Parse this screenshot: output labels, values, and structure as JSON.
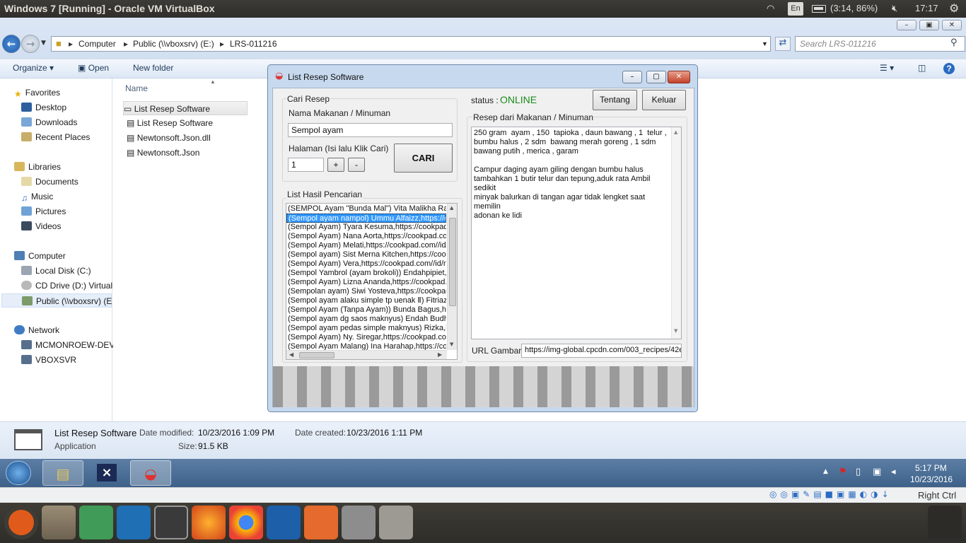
{
  "topbar": {
    "title": "Windows 7 [Running] - Oracle VM VirtualBox",
    "lang": "En",
    "battery": "(3:14, 86%)",
    "time": "17:17"
  },
  "explorer": {
    "breadcrumb": [
      "Computer",
      "Public (\\\\vboxsrv) (E:)",
      "LRS-011216"
    ],
    "search_placeholder": "Search LRS-011216",
    "cmd": {
      "organize": "Organize",
      "open": "Open",
      "new_folder": "New folder"
    },
    "column_name": "Name",
    "nav": {
      "favorites": "Favorites",
      "desktop": "Desktop",
      "downloads": "Downloads",
      "recent": "Recent Places",
      "libraries": "Libraries",
      "documents": "Documents",
      "music": "Music",
      "pictures": "Pictures",
      "videos": "Videos",
      "computer": "Computer",
      "local_disk": "Local Disk (C:)",
      "cd_drive": "CD Drive (D:) Virtual",
      "public": "Public (\\\\vboxsrv) (E",
      "network": "Network",
      "mcm": "MCMONROEW-DEV",
      "vboxsvr": "VBOXSVR"
    },
    "files": [
      "List Resep Software",
      "List Resep Software",
      "Newtonsoft.Json.dll",
      "Newtonsoft.Json"
    ],
    "details": {
      "name": "List Resep Software",
      "type": "Application",
      "modified_label": "Date modified:",
      "modified": "10/23/2016 1:09 PM",
      "created_label": "Date created:",
      "created": "10/23/2016 1:11 PM",
      "size_label": "Size:",
      "size": "91.5 KB"
    }
  },
  "taskbar": {
    "time": "5:17 PM",
    "date": "10/23/2016"
  },
  "vbox_status": {
    "host_key": "Right Ctrl"
  },
  "dialog": {
    "title": "List Resep Software",
    "group_search": "Cari Resep",
    "label_food": "Nama Makanan / Minuman",
    "food_value": "Sempol ayam",
    "label_page": "Halaman (Isi lalu Klik Cari)",
    "page_value": "1",
    "plus": "+",
    "minus": "-",
    "search_button": "CARI",
    "status_label": "status :",
    "status_value": "ONLINE",
    "about_button": "Tentang",
    "exit_button": "Keluar",
    "group_results": "List Hasil Pencarian",
    "group_recipe": "Resep dari Makanan / Minuman",
    "recipe_text": "250 gram  ayam , 150  tapioka , daun bawang , 1  telur ,\nbumbu halus , 2 sdm  bawang merah goreng , 1 sdm\nbawang putih , merica , garam\n\nCampur daging ayam giling dengan bumbu halus\ntambahkan 1 butir telur dan tepung,aduk rata Ambil sedikit\nminyak balurkan di tangan agar tidak lengket saat memilin\nadonan ke lidi",
    "url_label": "URL Gambar",
    "url_value": "https://img-global.cpcdn.com/003_recipes/42e",
    "results": [
      "(SEMPOL Ayam \"Bunda Mal\") Vita Malikha Rachma",
      "(Sempol ayam nampol) Ummu Alfaizz,https://cookpad",
      "(Sempol Ayam) Tyara Kesuma,https://cookpad.com",
      "(Sempol Ayam) Nana Aorta,https://cookpad.com/id",
      "(Sempol Ayam) Melati,https://cookpad.com//id/resep",
      "(Sempol ayam) Sist Merna Kitchen,https://cookpad",
      "(Sempol Ayam) Vera,https://cookpad.com//id/resep",
      "(Sempol Yambrol (ayam brokoli)) Endahpipiet,https",
      "(Sempol Ayam) Lizna Ananda,https://cookpad.com",
      "(Sempolan ayam) Siwi Yosteva,https://cookpad.com",
      "(Sempol ayam alaku simple tp uenak Ⅱ) Fitriaziza",
      "(Sempol Ayam (Tanpa Ayam)) Bunda Bagus,https",
      "(Sempol ayam dg saos maknyus) Endah Budhi P",
      "(Sempol ayam pedas simple maknyus) Rizka,https",
      "(Sempol Ayam) Ny. Siregar,https://cookpad.com",
      "(Sempol Ayam Malang) Ina Harahap,https://cookpad"
    ]
  },
  "colors": {
    "accent": "#3399ff",
    "online": "#1a8a1a"
  }
}
